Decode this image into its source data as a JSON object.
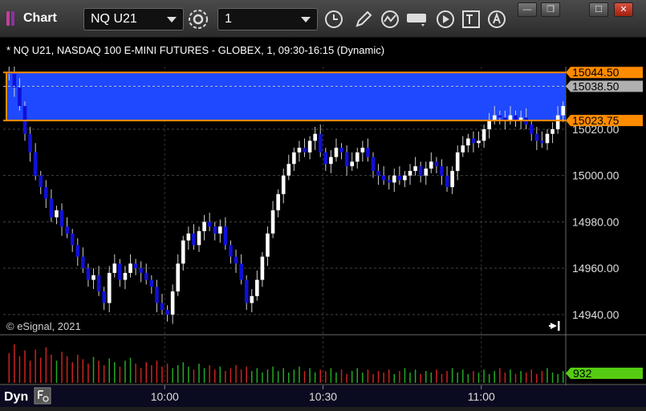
{
  "window": {
    "title": "Chart",
    "symbol": "NQ U21",
    "interval": "1",
    "buttons": {
      "minimize": "—",
      "restore": "❐",
      "maximize": "☐",
      "close": "✕"
    }
  },
  "chart_data": {
    "type": "candlestick",
    "title": "* NQ U21, NASDAQ 100 E-MINI FUTURES - GLOBEX, 1, 09:30-16:15 (Dynamic)",
    "copyright": "© eSignal, 2021",
    "y_ticks": [
      "15020.00",
      "15000.00",
      "14980.00",
      "14960.00",
      "14940.00"
    ],
    "y_tick_values": [
      15020,
      15000,
      14980,
      14960,
      14940
    ],
    "ylim": [
      14932,
      15047
    ],
    "x_ticks": [
      "10:00",
      "10:30",
      "11:00"
    ],
    "x_tick_bars": [
      30,
      60,
      90
    ],
    "bar_count": 106,
    "price_markers": [
      {
        "label": "15044.50",
        "value": 15044.5,
        "color": "#ff8c00"
      },
      {
        "label": "15038.50",
        "value": 15038.5,
        "color": "#b0b0b0"
      },
      {
        "label": "15023.75",
        "value": 15023.75,
        "color": "#ff8c00"
      }
    ],
    "zone": {
      "high": 15044.5,
      "low": 15023.75,
      "color": "#1f49ff"
    },
    "closes": [
      15044,
      15038,
      15030,
      15018,
      15010,
      15000,
      14995,
      14990,
      14982,
      14985,
      14978,
      14975,
      14970,
      14965,
      14960,
      14955,
      14957,
      14950,
      14945,
      14958,
      14962,
      14955,
      14958,
      14962,
      14960,
      14958,
      14955,
      14952,
      14945,
      14942,
      14940,
      14950,
      14962,
      14972,
      14975,
      14970,
      14976,
      14980,
      14978,
      14975,
      14978,
      14970,
      14965,
      14962,
      14955,
      14945,
      14948,
      14955,
      14965,
      14975,
      14985,
      14992,
      15000,
      15005,
      15010,
      15012,
      15010,
      15015,
      15018,
      15010,
      15005,
      15008,
      15012,
      15010,
      15004,
      15006,
      15010,
      15012,
      15008,
      15002,
      15000,
      14998,
      14997,
      15000,
      14998,
      15000,
      15002,
      15004,
      15000,
      15003,
      15006,
      15004,
      15000,
      14995,
      15002,
      15010,
      15013,
      15016,
      15014,
      15015,
      15020,
      15024,
      15026,
      15025,
      15024,
      15026,
      15024,
      15025,
      15022,
      15018,
      15015,
      15014,
      15018,
      15020,
      15026,
      15030
    ],
    "volumes": [
      40,
      52,
      36,
      44,
      30,
      45,
      34,
      48,
      38,
      30,
      42,
      36,
      28,
      38,
      32,
      26,
      35,
      30,
      24,
      33,
      28,
      22,
      30,
      34,
      26,
      20,
      28,
      24,
      30,
      22,
      26,
      20,
      24,
      28,
      22,
      18,
      26,
      20,
      24,
      18,
      22,
      16,
      20,
      24,
      18,
      22,
      16,
      20,
      14,
      18,
      22,
      16,
      20,
      14,
      18,
      22,
      16,
      20,
      14,
      18,
      16,
      20,
      14,
      18,
      12,
      16,
      20,
      14,
      18,
      12,
      16,
      14,
      18,
      12,
      16,
      20,
      14,
      18,
      12,
      16,
      14,
      18,
      12,
      16,
      20,
      14,
      18,
      12,
      16,
      14,
      18,
      12,
      16,
      20,
      14,
      18,
      12,
      16,
      14,
      18,
      12,
      16,
      20,
      14,
      12,
      16
    ],
    "volume_label": "932",
    "volume_label_color": "#55cc11",
    "dyn_label": "Dyn",
    "colors": {
      "up": "#ffffff",
      "down": "#1010d8",
      "vol_up": "#22aa22",
      "vol_down": "#cc2222"
    }
  }
}
